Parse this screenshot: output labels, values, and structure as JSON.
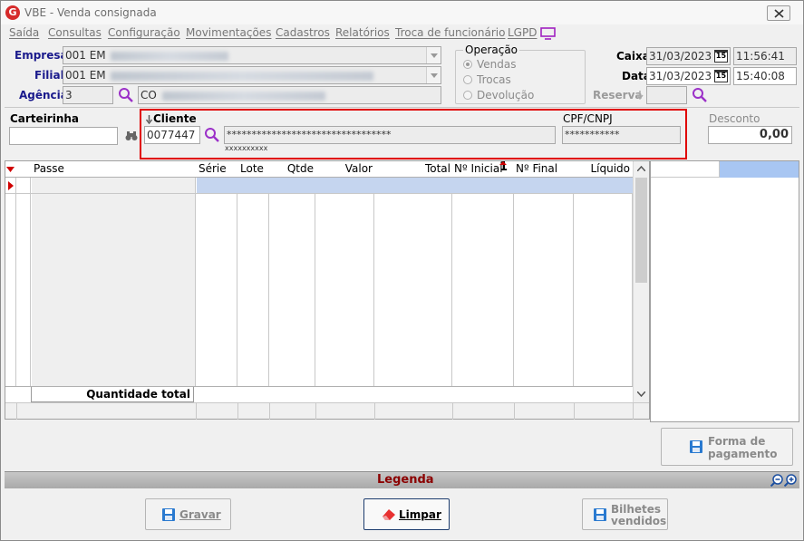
{
  "window": {
    "title": "VBE - Venda consignada",
    "close_label": "✕"
  },
  "menu": [
    "Saída",
    "Consultas",
    "Configuração",
    "Movimentações",
    "Cadastros",
    "Relatórios",
    "Troca de funcionário",
    "LGPD"
  ],
  "header": {
    "empresa_label": "Empresa",
    "empresa_value": "001 EM",
    "filial_label": "Filial",
    "filial_value": "001 EM",
    "agencia_label": "Agência",
    "agencia_code": "3",
    "agencia_name": "CO",
    "operacao_label": "Operação",
    "operacao_options": [
      {
        "label": "Vendas",
        "selected": true
      },
      {
        "label": "Trocas",
        "selected": false
      },
      {
        "label": "Devolução",
        "selected": false
      }
    ],
    "caixa_label": "Caixa",
    "caixa_date": "31/03/2023",
    "caixa_time": "11:56:41",
    "data_label": "Data",
    "data_date": "31/03/2023",
    "data_time": "15:40:08",
    "calendar_icon_text": "15",
    "reserva_label": "Reserva",
    "reserva_value": ""
  },
  "customer": {
    "carteirinha_label": "Carteirinha",
    "carteirinha_value": "",
    "cliente_label": "Cliente",
    "cliente_code": "0077447",
    "cliente_name": "*********************************",
    "cliente_sub": "xxxxxxxxxx",
    "cpf_label": "CPF/CNPJ",
    "cpf_value": "***********",
    "desconto_label": "Desconto",
    "desconto_value": "0,00"
  },
  "grid": {
    "columns": [
      "Passe",
      "Série",
      "Lote",
      "Qtde",
      "Valor",
      "Total",
      "Nº Inicial",
      "Nº Final",
      "Líquido"
    ],
    "sort_indicator": "1",
    "footer_label": "Quantidade total"
  },
  "buttons": {
    "forma_pagamento_line1": "Forma de",
    "forma_pagamento_line2": "pagamento",
    "gravar": "Gravar",
    "limpar": "Limpar",
    "bilhetes_line1": "Bilhetes",
    "bilhetes_line2": "vendidos"
  },
  "legend_bar": {
    "label": "Legenda"
  },
  "colors": {
    "label_blue": "#1a1a8c",
    "highlight_red": "#e00000",
    "row_select": "#c5d5ef",
    "legend_text": "#8b0000"
  }
}
